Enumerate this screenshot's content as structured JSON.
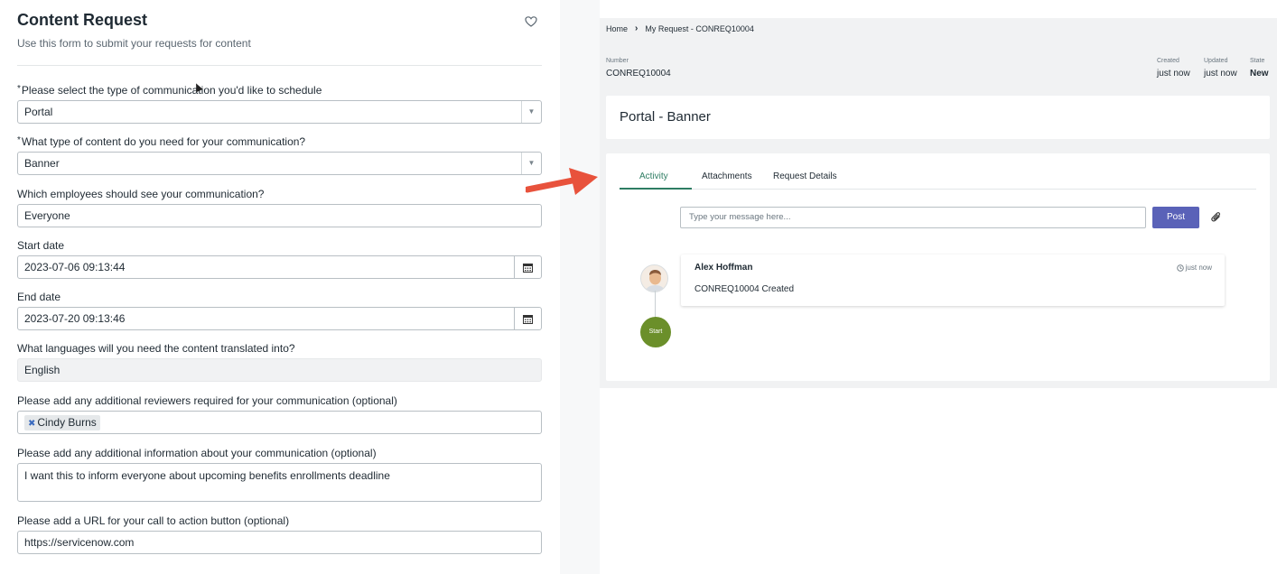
{
  "form": {
    "title": "Content Request",
    "subtitle": "Use this form to submit your requests for content",
    "fields": {
      "comm_type": {
        "label": "Please select the type of communication you'd like to schedule",
        "value": "Portal"
      },
      "content_type": {
        "label": "What type of content do you need for your communication?",
        "value": "Banner"
      },
      "audience": {
        "label": "Which employees should see your communication?",
        "value": "Everyone"
      },
      "start_date": {
        "label": "Start date",
        "value": "2023-07-06 09:13:44"
      },
      "end_date": {
        "label": "End date",
        "value": "2023-07-20 09:13:46"
      },
      "languages": {
        "label": "What languages will you need the content translated into?",
        "value": "English"
      },
      "reviewers": {
        "label": "Please add any additional reviewers required for your communication (optional)",
        "chip": "Cindy Burns"
      },
      "info": {
        "label": "Please add any additional information about your communication (optional)",
        "value": "I want this to inform everyone about upcoming benefits enrollments deadline"
      },
      "url": {
        "label": "Please add a URL for your call to action button (optional)",
        "value": "https://servicenow.com"
      }
    }
  },
  "request": {
    "breadcrumb": {
      "home": "Home",
      "current": "My Request - CONREQ10004"
    },
    "number_label": "Number",
    "number": "CONREQ10004",
    "meta": {
      "created_label": "Created",
      "created": "just now",
      "updated_label": "Updated",
      "updated": "just now",
      "state_label": "State",
      "state": "New"
    },
    "title": "Portal - Banner",
    "tabs": [
      "Activity",
      "Attachments",
      "Request Details"
    ],
    "message_placeholder": "Type your message here...",
    "post_label": "Post",
    "activity": {
      "author": "Alex Hoffman",
      "time": "just now",
      "text": "CONREQ10004 Created",
      "start_label": "Start"
    }
  },
  "colors": {
    "accent_tab": "#2e7d63",
    "post_button": "#5a62b8",
    "start_node": "#6b8f2a",
    "arrow": "#e8523c"
  }
}
